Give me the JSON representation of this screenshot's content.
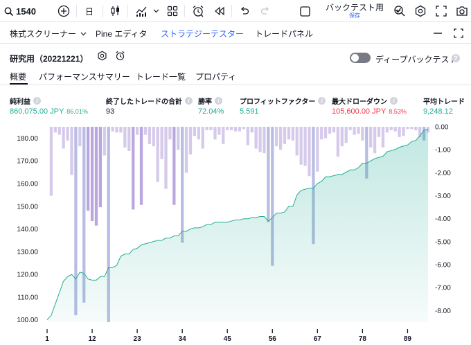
{
  "toolbar": {
    "symbol": "1540",
    "interval": "日",
    "backtest_label": "バックテスト用",
    "save_status": "保存"
  },
  "panel_tabs": [
    {
      "label": "株式スクリーナー"
    },
    {
      "label": "Pine エディタ"
    },
    {
      "label": "ストラテジーテスター"
    },
    {
      "label": "トレードパネル"
    }
  ],
  "strategy": {
    "title": "研究用（20221221）",
    "deep_backtest_label": "ディープバックテスト",
    "help_icon_glyph": "?"
  },
  "sub_tabs": [
    {
      "label": "概要"
    },
    {
      "label": "パフォーマンスサマリー"
    },
    {
      "label": "トレード一覧"
    },
    {
      "label": "プロパティ"
    }
  ],
  "info_glyph": "i",
  "metrics": [
    {
      "label": "純利益",
      "value": "860,075.00 JPY",
      "sub": "86.01%",
      "color": "#22ab94"
    },
    {
      "label": "終了したトレードの合計",
      "value": "93",
      "sub": "",
      "color": "#131722"
    },
    {
      "label": "勝率",
      "value": "72.04%",
      "sub": "",
      "color": "#22ab94"
    },
    {
      "label": "プロフィットファクター",
      "value": "5.591",
      "sub": "",
      "color": "#22ab94"
    },
    {
      "label": "最大ドローダウン",
      "value": "105,600.00 JPY",
      "sub": "8.53%",
      "color": "#f23645"
    },
    {
      "label": "平均トレード",
      "value": "9,248.12",
      "sub": "",
      "color": "#22ab94"
    }
  ],
  "colors": {
    "accent": "#2962ff",
    "equity_line": "#22ab94",
    "drawdown_bar": "#d1c4e9",
    "drawdown_bar_deep": "#b39ddb",
    "drawdown_bar_highlight": "#b0b6e0"
  },
  "chart_data": {
    "type": "area",
    "title": "",
    "xlabel": "",
    "left_axis": {
      "label": "",
      "ticks": [
        "100.00",
        "110.00",
        "120.00",
        "130.00",
        "140.00",
        "150.00",
        "160.00",
        "170.00",
        "180.00"
      ],
      "range": [
        99,
        185
      ]
    },
    "right_axis": {
      "label": "",
      "ticks": [
        "0.00",
        "-1.00",
        "-2.00",
        "-3.00",
        "-4.00",
        "-5.00",
        "-6.00",
        "-7.00",
        "-8.00"
      ],
      "range": [
        -8.5,
        0
      ]
    },
    "x_ticks": [
      "1",
      "12",
      "23",
      "34",
      "45",
      "56",
      "67",
      "78",
      "89"
    ],
    "x_range": [
      1,
      94
    ],
    "series": [
      {
        "name": "",
        "axis": "left",
        "x": [
          1,
          2,
          3,
          4,
          5,
          6,
          7,
          8,
          9,
          10,
          11,
          12,
          13,
          14,
          15,
          16,
          17,
          18,
          19,
          20,
          21,
          22,
          23,
          24,
          25,
          26,
          27,
          28,
          29,
          30,
          31,
          32,
          33,
          34,
          35,
          36,
          37,
          38,
          39,
          40,
          41,
          42,
          43,
          44,
          45,
          46,
          47,
          48,
          49,
          50,
          51,
          52,
          53,
          54,
          55,
          56,
          57,
          58,
          59,
          60,
          61,
          62,
          63,
          64,
          65,
          66,
          67,
          68,
          69,
          70,
          71,
          72,
          73,
          74,
          75,
          76,
          77,
          78,
          79,
          80,
          81,
          82,
          83,
          84,
          85,
          86,
          87,
          88,
          89,
          90,
          91,
          92,
          93,
          94
        ],
        "values": [
          100,
          102,
          107,
          112,
          117,
          119,
          120,
          118,
          121,
          120.5,
          118,
          117.5,
          117.5,
          119,
          119,
          123,
          123,
          124,
          128,
          129,
          129,
          131,
          131.5,
          133,
          133.5,
          134,
          134.5,
          135,
          135,
          136,
          136,
          137,
          137,
          139,
          139,
          140,
          140.5,
          140.5,
          141,
          142,
          142,
          143,
          143,
          143,
          143,
          143.5,
          144,
          144,
          144.5,
          144.5,
          145,
          145,
          145.5,
          145.5,
          143.5,
          145,
          147,
          147,
          147.5,
          150,
          150,
          155,
          157,
          157.5,
          158,
          158,
          160,
          161,
          163,
          163,
          163.5,
          164,
          164,
          165,
          166,
          166,
          167,
          169,
          169,
          170,
          171,
          171.5,
          172,
          174,
          174.5,
          175,
          176,
          176.5,
          177,
          178.5,
          179,
          181,
          183.5,
          184
        ]
      },
      {
        "name": "",
        "axis": "right",
        "x": [
          1,
          2,
          3,
          4,
          5,
          6,
          7,
          8,
          9,
          10,
          11,
          12,
          13,
          14,
          15,
          16,
          17,
          18,
          19,
          20,
          21,
          22,
          23,
          24,
          25,
          26,
          27,
          28,
          29,
          30,
          31,
          32,
          33,
          34,
          35,
          36,
          37,
          38,
          39,
          40,
          41,
          42,
          43,
          44,
          45,
          46,
          47,
          48,
          49,
          50,
          51,
          52,
          53,
          54,
          55,
          56,
          57,
          58,
          59,
          60,
          61,
          62,
          63,
          64,
          65,
          66,
          67,
          68,
          69,
          70,
          71,
          72,
          73,
          74,
          75,
          76,
          77,
          78,
          79,
          80,
          81,
          82,
          83,
          84,
          85,
          86,
          87,
          88,
          89,
          90,
          91,
          92,
          93,
          94
        ],
        "values": [
          0,
          -3.0,
          -0.25,
          -0.35,
          -0.95,
          -0.6,
          -2.1,
          -8.2,
          -0.85,
          -7.65,
          -3.65,
          -4.1,
          -4.3,
          -3.5,
          -1.25,
          -8.5,
          -0.2,
          -0.25,
          -0.25,
          -0.9,
          -1.05,
          -3.6,
          -0.35,
          -3.4,
          -0.35,
          -0.75,
          -0.85,
          -2.4,
          -1.4,
          -2.7,
          -0.55,
          -3.4,
          -1.0,
          -5.05,
          -2.0,
          -1.2,
          -0.4,
          -0.55,
          -0.95,
          -0.15,
          -0.15,
          -0.55,
          -0.35,
          -0.75,
          -0.15,
          -0.15,
          -0.2,
          -0.2,
          -0.1,
          -0.8,
          -0.25,
          -0.95,
          -1.1,
          -1.15,
          -4.15,
          -6.05,
          -0.85,
          -1.0,
          -0.75,
          -0.55,
          -0.6,
          -1.25,
          -1.65,
          -1.7,
          -2.15,
          -5.1,
          -1.95,
          -0.55,
          -0.5,
          -0.3,
          -0.25,
          -1.3,
          -0.85,
          -0.7,
          -0.15,
          -0.35,
          -0.3,
          -0.6,
          -2.25,
          -0.9,
          -1.15,
          -0.45,
          -0.9,
          -0.25,
          -0.15,
          -0.2,
          -0.45,
          -0.4,
          -0.1,
          -0.1,
          -0.15,
          -0.45,
          -0.6,
          -0.25
        ],
        "highlight_x": [
          8,
          10,
          16,
          34,
          55,
          56,
          66,
          79,
          93
        ]
      }
    ],
    "grid": false,
    "legend": "none"
  }
}
